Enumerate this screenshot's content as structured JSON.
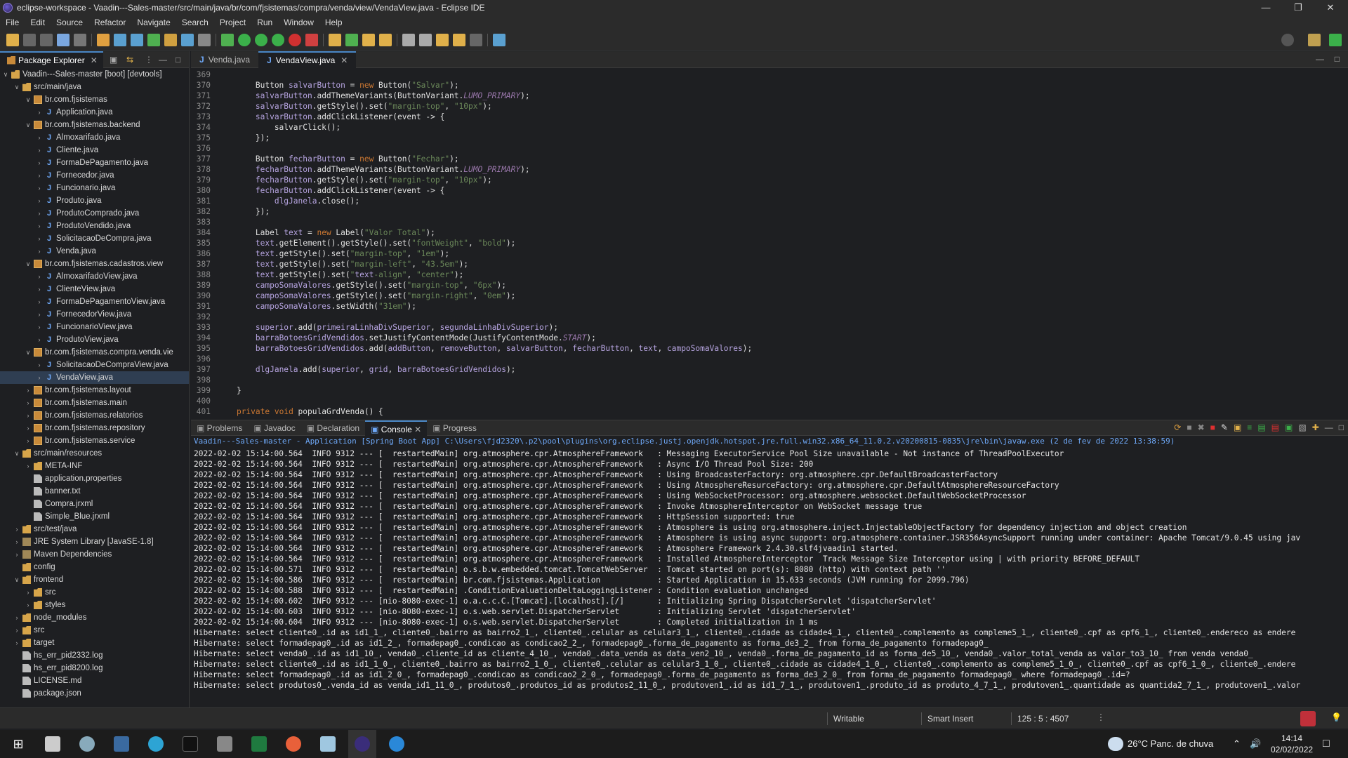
{
  "window": {
    "title": "eclipse-workspace - Vaadin---Sales-master/src/main/java/br/com/fjsistemas/compra/venda/view/VendaView.java - Eclipse IDE"
  },
  "menu": [
    "File",
    "Edit",
    "Source",
    "Refactor",
    "Navigate",
    "Search",
    "Project",
    "Run",
    "Window",
    "Help"
  ],
  "package_explorer": {
    "tab_label": "Package Explorer",
    "tree": [
      {
        "label": "Vaadin---Sales-master [boot] [devtools]",
        "depth": 0,
        "icon": "proj",
        "expanded": true
      },
      {
        "label": "src/main/java",
        "depth": 1,
        "icon": "folder",
        "expanded": true
      },
      {
        "label": "br.com.fjsistemas",
        "depth": 2,
        "icon": "pkg",
        "expanded": true
      },
      {
        "label": "Application.java",
        "depth": 3,
        "icon": "java"
      },
      {
        "label": "br.com.fjsistemas.backend",
        "depth": 2,
        "icon": "pkg",
        "expanded": true
      },
      {
        "label": "Almoxarifado.java",
        "depth": 3,
        "icon": "java"
      },
      {
        "label": "Cliente.java",
        "depth": 3,
        "icon": "java"
      },
      {
        "label": "FormaDePagamento.java",
        "depth": 3,
        "icon": "java"
      },
      {
        "label": "Fornecedor.java",
        "depth": 3,
        "icon": "java"
      },
      {
        "label": "Funcionario.java",
        "depth": 3,
        "icon": "java"
      },
      {
        "label": "Produto.java",
        "depth": 3,
        "icon": "java"
      },
      {
        "label": "ProdutoComprado.java",
        "depth": 3,
        "icon": "java"
      },
      {
        "label": "ProdutoVendido.java",
        "depth": 3,
        "icon": "java"
      },
      {
        "label": "SolicitacaoDeCompra.java",
        "depth": 3,
        "icon": "java"
      },
      {
        "label": "Venda.java",
        "depth": 3,
        "icon": "java"
      },
      {
        "label": "br.com.fjsistemas.cadastros.view",
        "depth": 2,
        "icon": "pkg",
        "expanded": true
      },
      {
        "label": "AlmoxarifadoView.java",
        "depth": 3,
        "icon": "java"
      },
      {
        "label": "ClienteView.java",
        "depth": 3,
        "icon": "java"
      },
      {
        "label": "FormaDePagamentoView.java",
        "depth": 3,
        "icon": "java"
      },
      {
        "label": "FornecedorView.java",
        "depth": 3,
        "icon": "java"
      },
      {
        "label": "FuncionarioView.java",
        "depth": 3,
        "icon": "java"
      },
      {
        "label": "ProdutoView.java",
        "depth": 3,
        "icon": "java"
      },
      {
        "label": "br.com.fjsistemas.compra.venda.vie",
        "depth": 2,
        "icon": "pkg",
        "expanded": true
      },
      {
        "label": "SolicitacaoDeCompraView.java",
        "depth": 3,
        "icon": "java"
      },
      {
        "label": "VendaView.java",
        "depth": 3,
        "icon": "java",
        "selected": true
      },
      {
        "label": "br.com.fjsistemas.layout",
        "depth": 2,
        "icon": "pkg"
      },
      {
        "label": "br.com.fjsistemas.main",
        "depth": 2,
        "icon": "pkg"
      },
      {
        "label": "br.com.fjsistemas.relatorios",
        "depth": 2,
        "icon": "pkg"
      },
      {
        "label": "br.com.fjsistemas.repository",
        "depth": 2,
        "icon": "pkg"
      },
      {
        "label": "br.com.fjsistemas.service",
        "depth": 2,
        "icon": "pkg"
      },
      {
        "label": "src/main/resources",
        "depth": 1,
        "icon": "folder",
        "expanded": true
      },
      {
        "label": "META-INF",
        "depth": 2,
        "icon": "folder"
      },
      {
        "label": "application.properties",
        "depth": 2,
        "icon": "file",
        "leaf": true
      },
      {
        "label": "banner.txt",
        "depth": 2,
        "icon": "file",
        "leaf": true
      },
      {
        "label": "Compra.jrxml",
        "depth": 2,
        "icon": "file",
        "leaf": true
      },
      {
        "label": "Simple_Blue.jrxml",
        "depth": 2,
        "icon": "file",
        "leaf": true
      },
      {
        "label": "src/test/java",
        "depth": 1,
        "icon": "folder"
      },
      {
        "label": "JRE System Library [JavaSE-1.8]",
        "depth": 1,
        "icon": "lib"
      },
      {
        "label": "Maven Dependencies",
        "depth": 1,
        "icon": "lib"
      },
      {
        "label": "config",
        "depth": 1,
        "icon": "folder",
        "leaf": true
      },
      {
        "label": "frontend",
        "depth": 1,
        "icon": "folder",
        "expanded": true
      },
      {
        "label": "src",
        "depth": 2,
        "icon": "folder"
      },
      {
        "label": "styles",
        "depth": 2,
        "icon": "folder"
      },
      {
        "label": "node_modules",
        "depth": 1,
        "icon": "folder"
      },
      {
        "label": "src",
        "depth": 1,
        "icon": "folder"
      },
      {
        "label": "target",
        "depth": 1,
        "icon": "folder"
      },
      {
        "label": "hs_err_pid2332.log",
        "depth": 1,
        "icon": "file",
        "leaf": true
      },
      {
        "label": "hs_err_pid8200.log",
        "depth": 1,
        "icon": "file",
        "leaf": true
      },
      {
        "label": "LICENSE.md",
        "depth": 1,
        "icon": "file",
        "leaf": true
      },
      {
        "label": "package.json",
        "depth": 1,
        "icon": "file",
        "leaf": true
      }
    ]
  },
  "editor": {
    "tabs": [
      {
        "label": "Venda.java",
        "active": false
      },
      {
        "label": "VendaView.java",
        "active": true
      }
    ],
    "lines": [
      {
        "n": "369",
        "t": ""
      },
      {
        "n": "370",
        "t": "        Button salvarButton = new Button(\"Salvar\");"
      },
      {
        "n": "371",
        "t": "        salvarButton.addThemeVariants(ButtonVariant.LUMO_PRIMARY);"
      },
      {
        "n": "372",
        "t": "        salvarButton.getStyle().set(\"margin-top\", \"10px\");"
      },
      {
        "n": "373",
        "t": "        salvarButton.addClickListener(event -> {"
      },
      {
        "n": "374",
        "t": "            salvarClick();"
      },
      {
        "n": "375",
        "t": "        });"
      },
      {
        "n": "376",
        "t": ""
      },
      {
        "n": "377",
        "t": "        Button fecharButton = new Button(\"Fechar\");"
      },
      {
        "n": "378",
        "t": "        fecharButton.addThemeVariants(ButtonVariant.LUMO_PRIMARY);"
      },
      {
        "n": "379",
        "t": "        fecharButton.getStyle().set(\"margin-top\", \"10px\");"
      },
      {
        "n": "380",
        "t": "        fecharButton.addClickListener(event -> {"
      },
      {
        "n": "381",
        "t": "            dlgJanela.close();"
      },
      {
        "n": "382",
        "t": "        });"
      },
      {
        "n": "383",
        "t": ""
      },
      {
        "n": "384",
        "t": "        Label text = new Label(\"Valor Total\");"
      },
      {
        "n": "385",
        "t": "        text.getElement().getStyle().set(\"fontWeight\", \"bold\");"
      },
      {
        "n": "386",
        "t": "        text.getStyle().set(\"margin-top\", \"1em\");"
      },
      {
        "n": "387",
        "t": "        text.getStyle().set(\"margin-left\", \"43.5em\");"
      },
      {
        "n": "388",
        "t": "        text.getStyle().set(\"text-align\", \"center\");"
      },
      {
        "n": "389",
        "t": "        campoSomaValores.getStyle().set(\"margin-top\", \"6px\");"
      },
      {
        "n": "390",
        "t": "        campoSomaValores.getStyle().set(\"margin-right\", \"0em\");"
      },
      {
        "n": "391",
        "t": "        campoSomaValores.setWidth(\"31em\");"
      },
      {
        "n": "392",
        "t": ""
      },
      {
        "n": "393",
        "t": "        superior.add(primeiraLinhaDivSuperior, segundaLinhaDivSuperior);"
      },
      {
        "n": "394",
        "t": "        barraBotoesGridVendidos.setJustifyContentMode(JustifyContentMode.START);"
      },
      {
        "n": "395",
        "t": "        barraBotoesGridVendidos.add(addButton, removeButton, salvarButton, fecharButton, text, campoSomaValores);"
      },
      {
        "n": "396",
        "t": ""
      },
      {
        "n": "397",
        "t": "        dlgJanela.add(superior, grid, barraBotoesGridVendidos);"
      },
      {
        "n": "398",
        "t": ""
      },
      {
        "n": "399",
        "t": "    }"
      },
      {
        "n": "400",
        "t": ""
      },
      {
        "n": "401",
        "t": "    private void populaGrdVenda() {"
      }
    ]
  },
  "console": {
    "tabs": [
      {
        "label": "Problems"
      },
      {
        "label": "Javadoc"
      },
      {
        "label": "Declaration"
      },
      {
        "label": "Console",
        "active": true
      },
      {
        "label": "Progress"
      }
    ],
    "header": "Vaadin---Sales-master - Application [Spring Boot App] C:\\Users\\fjd2320\\.p2\\pool\\plugins\\org.eclipse.justj.openjdk.hotspot.jre.full.win32.x86_64_11.0.2.v20200815-0835\\jre\\bin\\javaw.exe  (2 de fev de 2022 13:38:59)",
    "lines": [
      "2022-02-02 15:14:00.564  INFO 9312 --- [  restartedMain] org.atmosphere.cpr.AtmosphereFramework   : Messaging ExecutorService Pool Size unavailable - Not instance of ThreadPoolExecutor",
      "2022-02-02 15:14:00.564  INFO 9312 --- [  restartedMain] org.atmosphere.cpr.AtmosphereFramework   : Async I/O Thread Pool Size: 200",
      "2022-02-02 15:14:00.564  INFO 9312 --- [  restartedMain] org.atmosphere.cpr.AtmosphereFramework   : Using BroadcasterFactory: org.atmosphere.cpr.DefaultBroadcasterFactory",
      "2022-02-02 15:14:00.564  INFO 9312 --- [  restartedMain] org.atmosphere.cpr.AtmosphereFramework   : Using AtmosphereResurceFactory: org.atmosphere.cpr.DefaultAtmosphereResourceFactory",
      "2022-02-02 15:14:00.564  INFO 9312 --- [  restartedMain] org.atmosphere.cpr.AtmosphereFramework   : Using WebSocketProcessor: org.atmosphere.websocket.DefaultWebSocketProcessor",
      "2022-02-02 15:14:00.564  INFO 9312 --- [  restartedMain] org.atmosphere.cpr.AtmosphereFramework   : Invoke AtmosphereInterceptor on WebSocket message true",
      "2022-02-02 15:14:00.564  INFO 9312 --- [  restartedMain] org.atmosphere.cpr.AtmosphereFramework   : HttpSession supported: true",
      "2022-02-02 15:14:00.564  INFO 9312 --- [  restartedMain] org.atmosphere.cpr.AtmosphereFramework   : Atmosphere is using org.atmosphere.inject.InjectableObjectFactory for dependency injection and object creation",
      "2022-02-02 15:14:00.564  INFO 9312 --- [  restartedMain] org.atmosphere.cpr.AtmosphereFramework   : Atmosphere is using async support: org.atmosphere.container.JSR356AsyncSupport running under container: Apache Tomcat/9.0.45 using jav",
      "2022-02-02 15:14:00.564  INFO 9312 --- [  restartedMain] org.atmosphere.cpr.AtmosphereFramework   : Atmosphere Framework 2.4.30.slf4jvaadin1 started.",
      "2022-02-02 15:14:00.564  INFO 9312 --- [  restartedMain] org.atmosphere.cpr.AtmosphereFramework   : Installed AtmosphereInterceptor  Track Message Size Interceptor using | with priority BEFORE_DEFAULT",
      "2022-02-02 15:14:00.571  INFO 9312 --- [  restartedMain] o.s.b.w.embedded.tomcat.TomcatWebServer  : Tomcat started on port(s): 8080 (http) with context path ''",
      "2022-02-02 15:14:00.586  INFO 9312 --- [  restartedMain] br.com.fjsistemas.Application            : Started Application in 15.633 seconds (JVM running for 2099.796)",
      "2022-02-02 15:14:00.588  INFO 9312 --- [  restartedMain] .ConditionEvaluationDeltaLoggingListener : Condition evaluation unchanged",
      "2022-02-02 15:14:00.602  INFO 9312 --- [nio-8080-exec-1] o.a.c.c.C.[Tomcat].[localhost].[/]       : Initializing Spring DispatcherServlet 'dispatcherServlet'",
      "2022-02-02 15:14:00.603  INFO 9312 --- [nio-8080-exec-1] o.s.web.servlet.DispatcherServlet        : Initializing Servlet 'dispatcherServlet'",
      "2022-02-02 15:14:00.604  INFO 9312 --- [nio-8080-exec-1] o.s.web.servlet.DispatcherServlet        : Completed initialization in 1 ms",
      "Hibernate: select cliente0_.id as id1_1_, cliente0_.bairro as bairro2_1_, cliente0_.celular as celular3_1_, cliente0_.cidade as cidade4_1_, cliente0_.complemento as compleme5_1_, cliente0_.cpf as cpf6_1_, cliente0_.endereco as endere",
      "Hibernate: select formadepag0_.id as id1_2_, formadepag0_.condicao as condicao2_2_, formadepag0_.forma_de_pagamento as forma_de3_2_ from forma_de_pagamento formadepag0_",
      "Hibernate: select venda0_.id as id1_10_, venda0_.cliente_id as cliente_4_10_, venda0_.data_venda as data_ven2_10_, venda0_.forma_de_pagamento_id as forma_de5_10_, venda0_.valor_total_venda as valor_to3_10_ from venda venda0_",
      "Hibernate: select cliente0_.id as id1_1_0_, cliente0_.bairro as bairro2_1_0_, cliente0_.celular as celular3_1_0_, cliente0_.cidade as cidade4_1_0_, cliente0_.complemento as compleme5_1_0_, cliente0_.cpf as cpf6_1_0_, cliente0_.endere",
      "Hibernate: select formadepag0_.id as id1_2_0_, formadepag0_.condicao as condicao2_2_0_, formadepag0_.forma_de_pagamento as forma_de3_2_0_ from forma_de_pagamento formadepag0_ where formadepag0_.id=?",
      "Hibernate: select produtos0_.venda_id as venda_id1_11_0_, produtos0_.produtos_id as produtos2_11_0_, produtoven1_.id as id1_7_1_, produtoven1_.produto_id as produto_4_7_1_, produtoven1_.quantidade as quantida2_7_1_, produtoven1_.valor"
    ]
  },
  "status": {
    "mode": "Writable",
    "insert": "Smart Insert",
    "position": "125 : 5 : 4507"
  },
  "taskbar": {
    "weather": "26°C  Panc. de chuva",
    "time": "14:14",
    "date": "02/02/2022"
  },
  "colors": {
    "keyword": "#cc7832",
    "string": "#6a8759",
    "field": "#9876aa",
    "accent": "#4a88c7"
  }
}
